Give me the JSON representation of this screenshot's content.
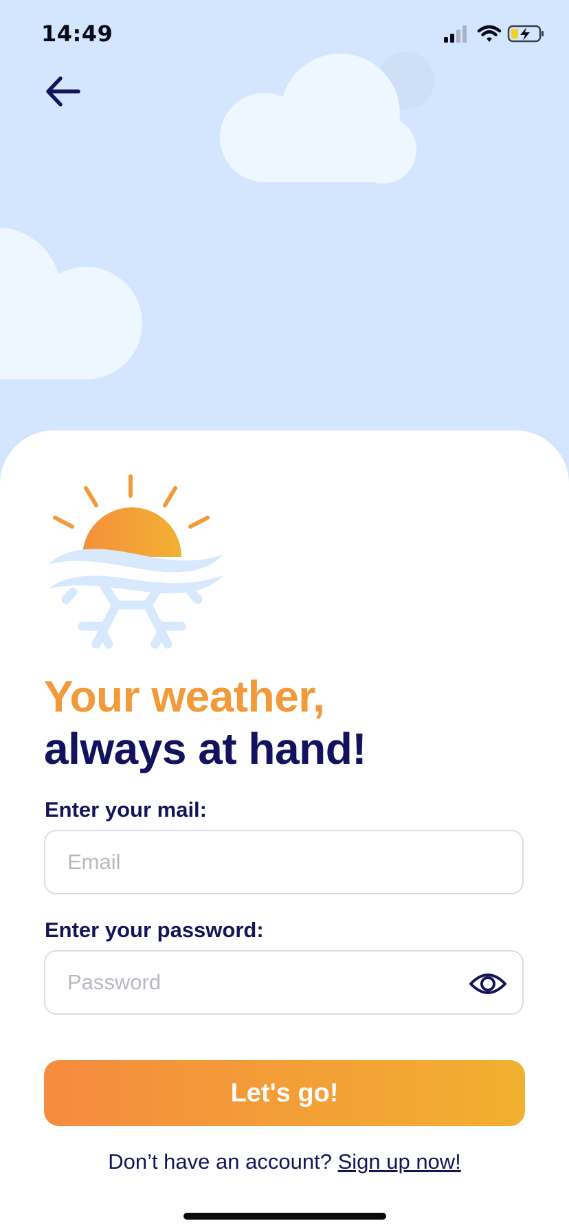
{
  "status_bar": {
    "time": "14:49",
    "icons": [
      "signal-icon",
      "wifi-icon",
      "battery-charging-icon"
    ]
  },
  "navigation": {
    "back_icon": "arrow-left-icon"
  },
  "headline": {
    "line1": "Your weather,",
    "line2": "always at hand!"
  },
  "form": {
    "email_label": "Enter your mail:",
    "email_placeholder": "Email",
    "email_value": "",
    "password_label": "Enter your password:",
    "password_placeholder": "Password",
    "password_value": "",
    "password_toggle_icon": "eye-icon",
    "submit_label": "Let's go!"
  },
  "signup": {
    "prompt": "Don’t have an account?",
    "link_label": "Sign up now!"
  },
  "colors": {
    "sky": "#d4e6fd",
    "accent_orange": "#f29a3a",
    "navy": "#14145a",
    "button_gradient_start": "#f58b3f",
    "button_gradient_end": "#f1b02f"
  }
}
